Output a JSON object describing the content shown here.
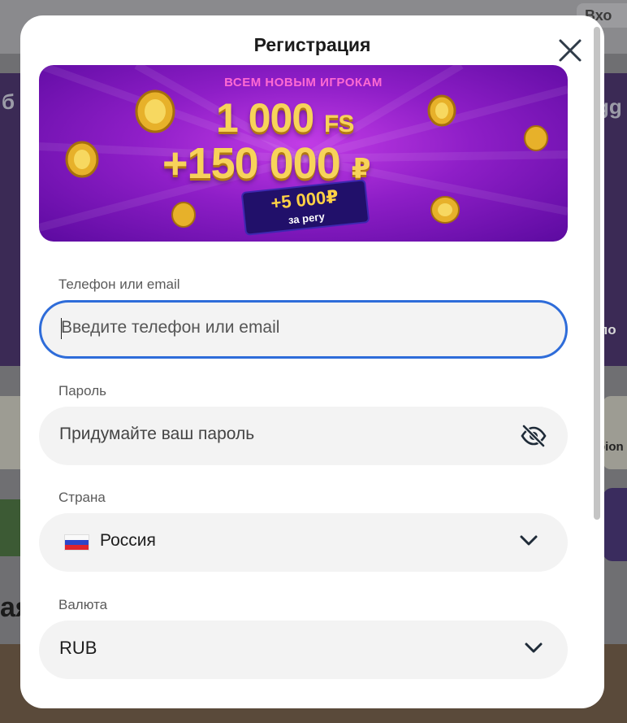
{
  "background": {
    "login_label": "Вхо",
    "left_fragment": "б",
    "right_fragment": "gg",
    "heading_fragment": "ая",
    "right_caption_fragment": "по",
    "right_icon_fragment": "pion"
  },
  "modal": {
    "title": "Регистрация",
    "close_icon": "close-icon"
  },
  "promo": {
    "headline": "ВСЕМ НОВЫМ ИГРОКАМ",
    "free_spins_amount": "1 000",
    "free_spins_unit": "FS",
    "bonus_amount": "+150 000",
    "bonus_currency": "₽",
    "registration_bonus_amount": "+5 000₽",
    "registration_bonus_caption": "за регу"
  },
  "form": {
    "contact": {
      "label": "Телефон или email",
      "placeholder": "Введите телефон или email",
      "value": ""
    },
    "password": {
      "label": "Пароль",
      "placeholder": "Придумайте ваш пароль",
      "toggle_icon": "eye-slash-icon"
    },
    "country": {
      "label": "Страна",
      "selected": "Россия",
      "flag_icon": "russia-flag-icon"
    },
    "currency": {
      "label": "Валюта",
      "selected": "RUB"
    }
  },
  "colors": {
    "focus_border": "#2e6cd9",
    "promo_purple": "#8e1ec7",
    "field_background": "#f3f3f3"
  }
}
